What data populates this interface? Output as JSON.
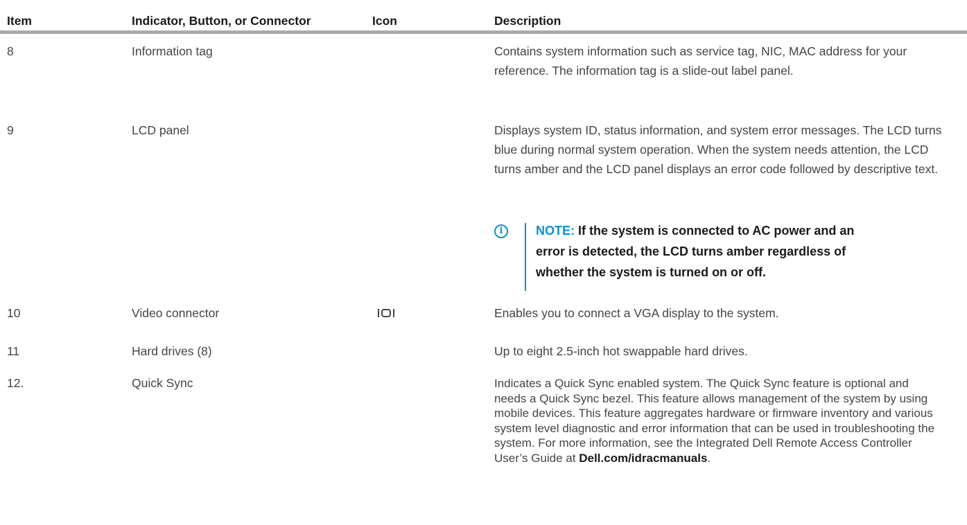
{
  "header": {
    "item": "Item",
    "indicator": "Indicator, Button, or Connector",
    "icon": "Icon",
    "description": "Description"
  },
  "rows": [
    {
      "item": "8",
      "indicator": "Information tag",
      "description": "Contains system information such as service tag, NIC, MAC address for your reference. The information tag is a slide-out label panel."
    },
    {
      "item": "9",
      "indicator": "LCD panel",
      "description": "Displays system ID, status information, and system error messages. The LCD turns blue during normal system operation. When the system needs attention, the LCD turns amber and the LCD panel displays an error code followed by descriptive text.",
      "note_label": "NOTE:",
      "note_text": "If the system is connected to AC power and an error is detected, the LCD turns amber regardless of whether the system is turned on or off."
    },
    {
      "item": "10",
      "indicator": "Video connector",
      "icon": "vga-connector-icon",
      "description": "Enables you to connect a VGA display to the system."
    },
    {
      "item": "11",
      "indicator": "Hard drives (8)",
      "description": "Up to eight 2.5-inch hot swappable hard drives."
    },
    {
      "item": "12.",
      "indicator": "Quick Sync",
      "description": "Indicates a Quick Sync enabled system. The Quick Sync feature is optional and needs a Quick Sync bezel. This feature allows management of the system by using mobile devices. This feature aggregates hardware or firmware inventory and various system level diagnostic and error information that can be used in troubleshooting the system. For more information, see the Integrated Dell Remote Access Controller User’s Guide at",
      "link": "Dell.com/idracmanuals",
      "suffix": "."
    }
  ],
  "colors": {
    "note_accent": "#0b8fd8",
    "header_rule": "#aaaaaa",
    "body_text": "#444444"
  }
}
